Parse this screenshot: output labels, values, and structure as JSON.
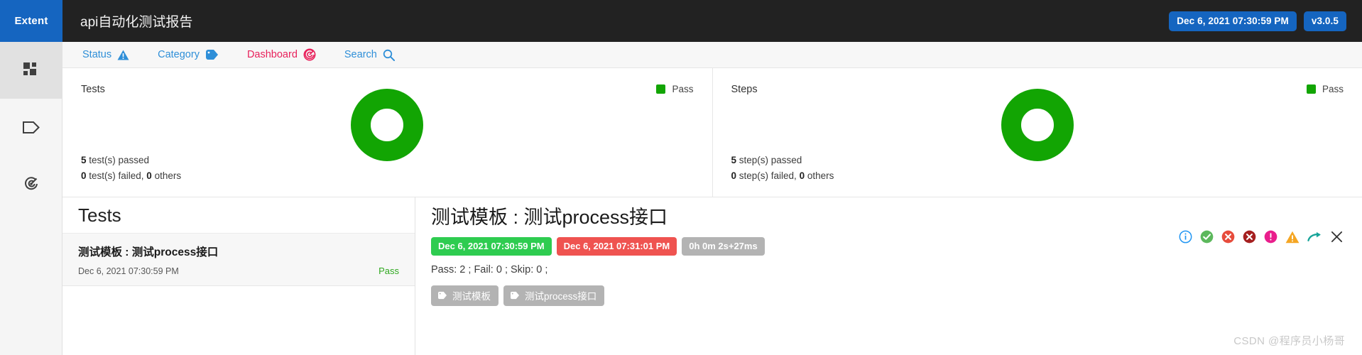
{
  "topbar": {
    "brand": "Extent",
    "report_title": "api自动化测试报告",
    "timestamp_badge": "Dec 6, 2021 07:30:59 PM",
    "version_badge": "v3.0.5",
    "brand_bg": "#1565c0",
    "bar_bg": "#222222"
  },
  "rail": {
    "items": [
      {
        "icon": "dashboard-grid-icon",
        "name": "sidebar-item-dashboard",
        "active": true
      },
      {
        "icon": "tag-icon",
        "name": "sidebar-item-categories",
        "active": false
      },
      {
        "icon": "target-icon",
        "name": "sidebar-item-exceptions",
        "active": false
      }
    ]
  },
  "nav": {
    "items": [
      {
        "label": "Status",
        "icon": "warning-triangle-icon",
        "active": false,
        "color": "#2f8fd8"
      },
      {
        "label": "Category",
        "icon": "tag-icon",
        "active": false,
        "color": "#2f8fd8"
      },
      {
        "label": "Dashboard",
        "icon": "target-icon",
        "active": true,
        "color": "#e8215b"
      },
      {
        "label": "Search",
        "icon": "search-icon",
        "active": false,
        "color": "#2f8fd8"
      }
    ]
  },
  "cards": [
    {
      "title": "Tests",
      "legend_label": "Pass",
      "passed_line_count": "5",
      "passed_line_text": " test(s) passed",
      "failed_count": "0",
      "failed_text": " test(s) failed, ",
      "others_count": "0",
      "others_text": " others"
    },
    {
      "title": "Steps",
      "legend_label": "Pass",
      "passed_line_count": "5",
      "passed_line_text": " step(s) passed",
      "failed_count": "0",
      "failed_text": " step(s) failed, ",
      "others_count": "0",
      "others_text": " others"
    }
  ],
  "chart_data": [
    {
      "type": "pie",
      "title": "Tests",
      "labels": [
        "Pass"
      ],
      "values": [
        5
      ],
      "colors": [
        "#12a503"
      ],
      "total": 5,
      "donut": true,
      "legend_position": "top-right"
    },
    {
      "type": "pie",
      "title": "Steps",
      "labels": [
        "Pass"
      ],
      "values": [
        5
      ],
      "colors": [
        "#12a503"
      ],
      "total": 5,
      "donut": true,
      "legend_position": "top-right"
    }
  ],
  "tests_panel": {
    "heading": "Tests",
    "rows": [
      {
        "name": "测试模板 : 测试process接口",
        "time": "Dec 6, 2021 07:30:59 PM",
        "status": "Pass",
        "status_color": "#2fa81f"
      }
    ]
  },
  "detail": {
    "title": "测试模板 : 测试process接口",
    "start_badge": "Dec 6, 2021 07:30:59 PM",
    "end_badge": "Dec 6, 2021 07:31:01 PM",
    "duration_badge": "0h 0m 2s+27ms",
    "counts": "Pass: 2 ; Fail: 0 ; Skip: 0 ;",
    "tags": [
      "测试模板",
      "测试process接口"
    ],
    "status_icons": [
      {
        "name": "info-icon",
        "color": "#2196f3"
      },
      {
        "name": "check-circle-icon",
        "color": "#5cb85c"
      },
      {
        "name": "fail-circle-icon",
        "color": "#e74c3c"
      },
      {
        "name": "fatal-circle-icon",
        "color": "#a52020"
      },
      {
        "name": "error-circle-icon",
        "color": "#e91e8c"
      },
      {
        "name": "warning-triangle-icon",
        "color": "#f5a623"
      },
      {
        "name": "skip-arrow-icon",
        "color": "#17a499"
      },
      {
        "name": "close-icon",
        "color": "#333333"
      }
    ]
  },
  "watermark": "CSDN @程序员小杨哥"
}
